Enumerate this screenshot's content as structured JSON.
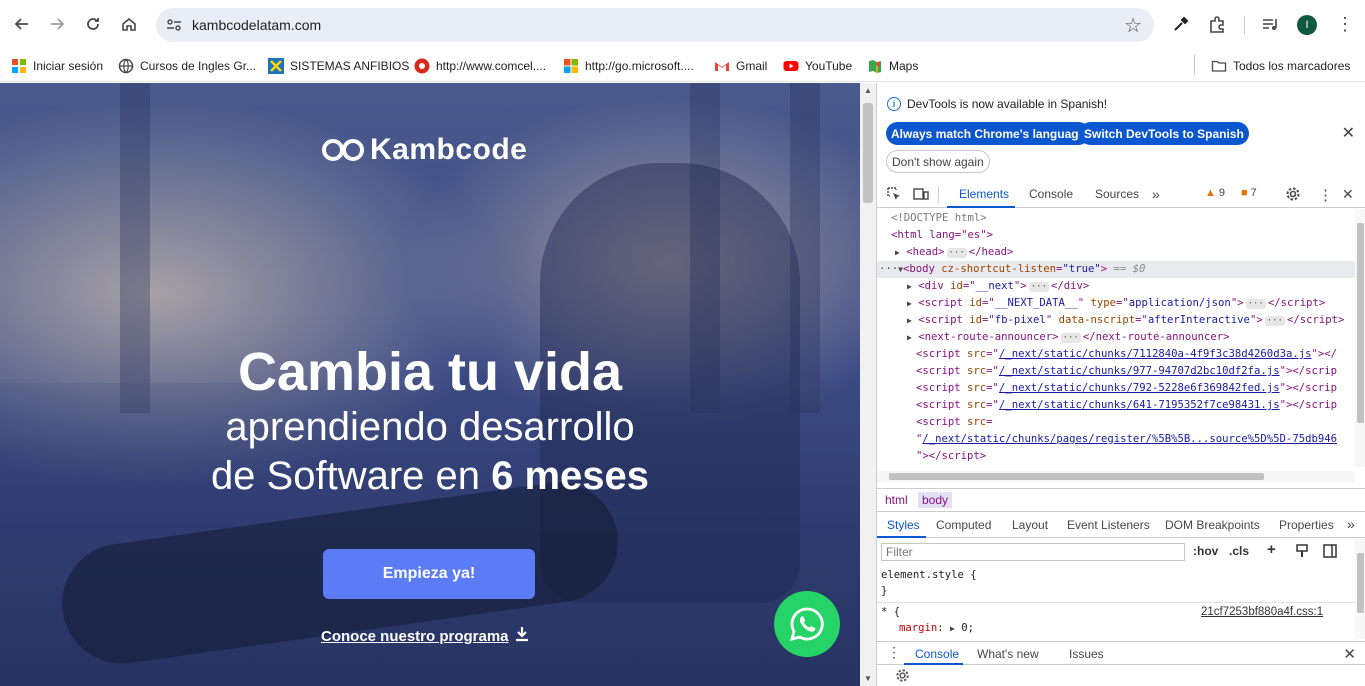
{
  "browser": {
    "url": "kambcodelatam.com",
    "avatar_letter": "I"
  },
  "bookmarks": {
    "items": [
      {
        "label": "Iniciar sesión",
        "icon": "app-icon"
      },
      {
        "label": "Cursos de Ingles Gr...",
        "icon": "globe-icon"
      },
      {
        "label": "SISTEMAS ANFIBIOS",
        "icon": "x-logo-icon"
      },
      {
        "label": "http://www.comcel....",
        "icon": "claro-icon"
      },
      {
        "label": "http://go.microsoft....",
        "icon": "microsoft-icon"
      },
      {
        "label": "Gmail",
        "icon": "gmail-icon"
      },
      {
        "label": "YouTube",
        "icon": "youtube-icon"
      },
      {
        "label": "Maps",
        "icon": "maps-icon"
      }
    ],
    "all_bookmarks": "Todos los marcadores"
  },
  "page": {
    "brand": "Kambcode",
    "headline": "Cambia tu vida",
    "subline1": "aprendiendo desarrollo",
    "subline2_prefix": "de Software en ",
    "subline2_bold": "6 meses",
    "cta_label": "Empieza ya!",
    "program_link": "Conoce nuestro programa",
    "accent": "#5b7cf5",
    "whatsapp_color": "#25d366"
  },
  "devtools": {
    "info": "DevTools is now available in Spanish!",
    "btn_always": "Always match Chrome's language",
    "btn_switch": "Switch DevTools to Spanish",
    "btn_dont_show": "Don't show again",
    "tabs": [
      "Elements",
      "Console",
      "Sources"
    ],
    "warnings": "9",
    "errors": "7",
    "code": {
      "doctype": "<!DOCTYPE html>",
      "html_open": "<html lang=\"es\">",
      "head": "<head>",
      "head_close": "</head>",
      "body_attr": "cz-shortcut-listen",
      "body_attr_val": "\"true\"",
      "eq": "== $0",
      "div_next": "__next",
      "script_next_data_id": "__NEXT_DATA__",
      "script_next_data_type": "application/json",
      "script_fb_id": "fb-pixel",
      "script_fb_attr": "data-nscript",
      "script_fb_val": "afterInteractive",
      "announcer": "next-route-announcer",
      "chunk1": "/_next/static/chunks/7112840a-4f9f3c38d4260d3a.js",
      "chunk2": "/_next/static/chunks/977-94707d2bc10df2fa.js",
      "chunk3": "/_next/static/chunks/792-5228e6f369842fed.js",
      "chunk4": "/_next/static/chunks/641-7195352f7ce98431.js",
      "chunk5": "/_next/static/chunks/pages/register/%5B%5B...source%5D%5D-75db946"
    },
    "crumbs": [
      "html",
      "body"
    ],
    "subtabs": [
      "Styles",
      "Computed",
      "Layout",
      "Event Listeners",
      "DOM Breakpoints",
      "Properties"
    ],
    "filter_placeholder": "Filter",
    "hov": ":hov",
    "cls": ".cls",
    "element_style": "element.style {",
    "close_brace": "}",
    "universal": "* {",
    "source_file": "21cf7253bf880a4f.css:1",
    "margin_prop": "margin",
    "margin_val": "0;",
    "drawer_tabs": [
      "Console",
      "What's new",
      "Issues"
    ]
  }
}
